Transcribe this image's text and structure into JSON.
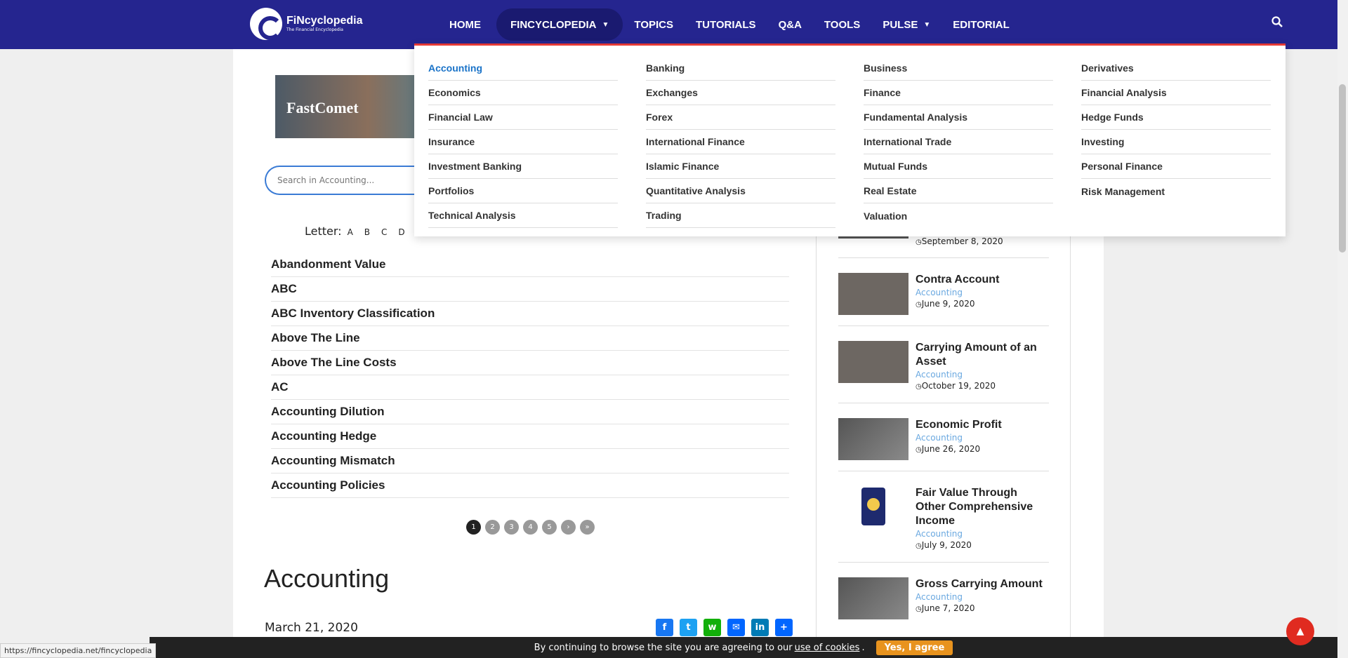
{
  "header": {
    "logo_name": "FiNcyclopedia",
    "logo_tagline": "The Financial Encyclopedia",
    "nav": [
      "HOME",
      "FINCYCLOPEDIA",
      "TOPICS",
      "TUTORIALS",
      "Q&A",
      "TOOLS",
      "PULSE",
      "EDITORIAL"
    ]
  },
  "mega_menu": {
    "columns": [
      [
        "Accounting",
        "Economics",
        "Financial Law",
        "Insurance",
        "Investment Banking",
        "Portfolios",
        "Technical Analysis"
      ],
      [
        "Banking",
        "Exchanges",
        "Forex",
        "International Finance",
        "Islamic Finance",
        "Quantitative Analysis",
        "Trading"
      ],
      [
        "Business",
        "Finance",
        "Fundamental Analysis",
        "International Trade",
        "Mutual Funds",
        "Real Estate",
        "Valuation"
      ],
      [
        "Derivatives",
        "Financial Analysis",
        "Hedge Funds",
        "Investing",
        "Personal Finance",
        "Risk Management"
      ]
    ],
    "active": "Accounting"
  },
  "banner": {
    "text": "FastComet"
  },
  "search": {
    "placeholder": "Search in Accounting..."
  },
  "letters": {
    "label": "Letter:",
    "items": [
      "A",
      "B",
      "C",
      "D"
    ]
  },
  "terms": [
    "Abandonment Value",
    "ABC",
    "ABC Inventory Classification",
    "Above The Line",
    "Above The Line Costs",
    "AC",
    "Accounting Dilution",
    "Accounting Hedge",
    "Accounting Mismatch",
    "Accounting Policies"
  ],
  "pager": [
    "1",
    "2",
    "3",
    "4",
    "5",
    "›",
    "»"
  ],
  "article": {
    "title": "Accounting",
    "date": "March 21, 2020"
  },
  "share_buttons": [
    "f",
    "t",
    "w",
    "✉",
    "in",
    "+"
  ],
  "sidebar_posts": [
    {
      "title": "",
      "category": "",
      "date": "September 8, 2020"
    },
    {
      "title": "Contra Account",
      "category": "Accounting",
      "date": "June 9, 2020"
    },
    {
      "title": "Carrying Amount of an Asset",
      "category": "Accounting",
      "date": "October 19, 2020"
    },
    {
      "title": "Economic Profit",
      "category": "Accounting",
      "date": "June 26, 2020"
    },
    {
      "title": "Fair Value Through Other Comprehensive Income",
      "category": "Accounting",
      "date": "July 9, 2020"
    },
    {
      "title": "Gross Carrying Amount",
      "category": "Accounting",
      "date": "June 7, 2020"
    }
  ],
  "cookie": {
    "text": "By continuing to browse the site you are agreeing to our",
    "link": "use of cookies",
    "button": "Yes, I agree"
  },
  "status_url": "https://fincyclopedia.net/fincyclopedia",
  "colors": {
    "header": "#25258f",
    "accent_red": "#e53935",
    "link_blue": "#1a73c8",
    "cookie_btn": "#e8931e"
  }
}
